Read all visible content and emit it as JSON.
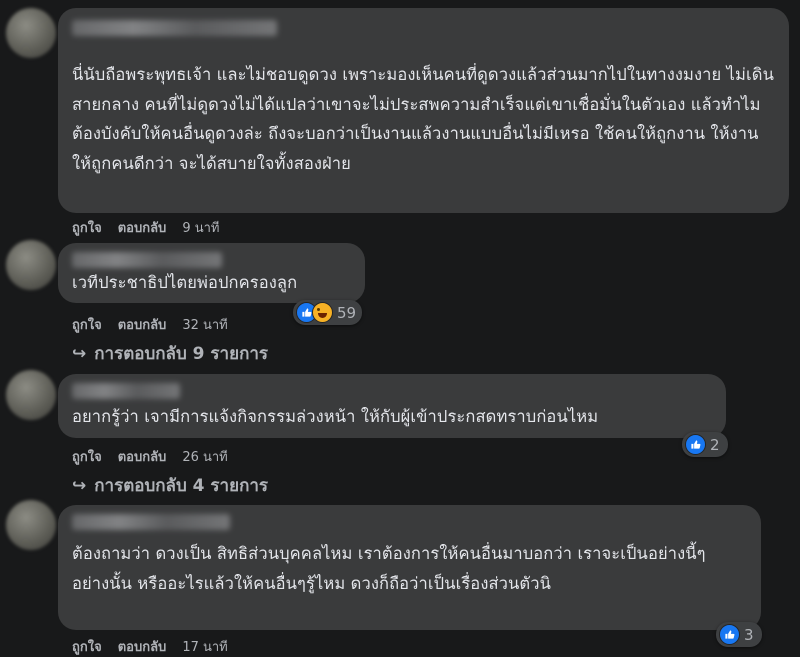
{
  "actions": {
    "like_label": "ถูกใจ",
    "reply_label": "ตอบกลับ"
  },
  "comments": [
    {
      "text": "นี่นับถือพระพุทธเจ้า และไม่ชอบดูดวง เพราะมองเห็นคนที่ดูดวงแล้วส่วนมากไปในทางงมงาย ไม่เดินสายกลาง คนที่ไม่ดูดวงไม่ได้แปลว่าเขาจะไม่ประสพความสำเร็จแต่เขาเชื่อมั่นในตัวเอง แล้วทำไมต้องบังคับให้คนอื่นดูดวงล่ะ ถึงจะบอกว่าเป็นงานแล้วงานแบบอื่นไม่มีเหรอ ใช้คนให้ถูกงาน ให้งานให้ถูกคนดีกว่า จะได้สบายใจทั้งสองฝ่าย",
      "time": "9 นาที"
    },
    {
      "text": "เวทีประชาธิปไตยพ่อปกครองลูก",
      "time": "32 นาที",
      "reaction_count": "59",
      "replies": "การตอบกลับ 9 รายการ"
    },
    {
      "text": "อยากรู้ว่า เจามีการแจ้งกิจกรรมล่วงหน้า ให้กับผู้เข้าประกสดทราบก่อนไหม",
      "time": "26 นาที",
      "reaction_count": "2",
      "replies": "การตอบกลับ 4 รายการ"
    },
    {
      "text": "ต้องถามว่า ดวงเป็น สิทธิส่วนบุคคลไหม เราต้องการให้คนอื่นมาบอกว่า เราจะเป็นอย่างนี้ๆ อย่างนั้น หรืออะไรแล้วให้คนอื่นๆรู้ไหม ดวงก็ถือว่าเป็นเรื่องส่วนตัวนิ",
      "time": "17 นาที",
      "reaction_count": "3"
    }
  ]
}
